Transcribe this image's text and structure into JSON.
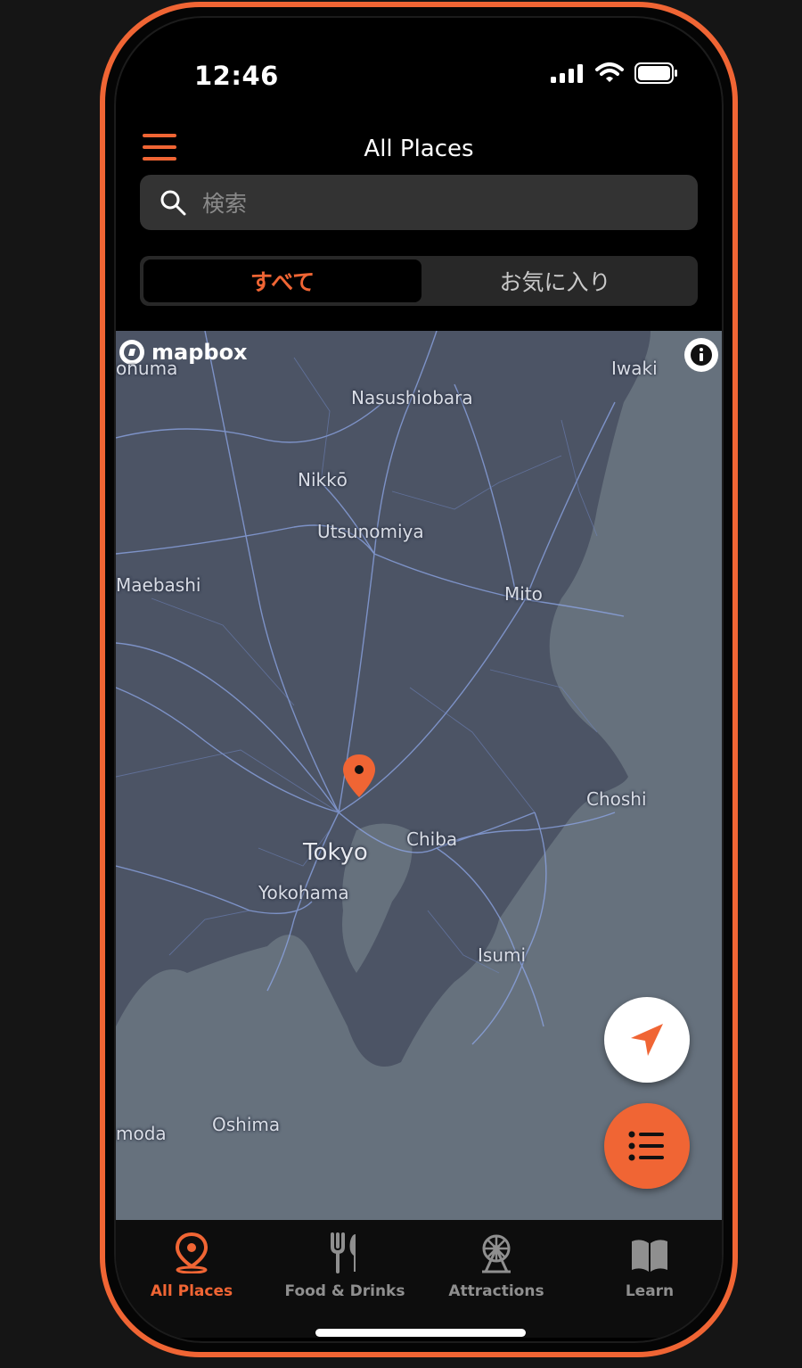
{
  "status_bar": {
    "time": "12:46"
  },
  "header": {
    "title": "All Places"
  },
  "search": {
    "placeholder": "検索"
  },
  "segment": {
    "all_label": "すべて",
    "favorites_label": "お気に入り",
    "selected": "all"
  },
  "map": {
    "attribution": "mapbox",
    "labels": [
      "onuma",
      "Iwaki",
      "Nasushiobara",
      "Nikkō",
      "Utsunomiya",
      "Maebashi",
      "Mito",
      "Choshi",
      "Chiba",
      "Tokyo",
      "Yokohama",
      "Isumi",
      "Oshima",
      "moda"
    ]
  },
  "tabs": [
    {
      "label": "All Places",
      "icon": "map-pin-icon",
      "active": true
    },
    {
      "label": "Food & Drinks",
      "icon": "fork-knife-icon",
      "active": false
    },
    {
      "label": "Attractions",
      "icon": "ferris-wheel-icon",
      "active": false
    },
    {
      "label": "Learn",
      "icon": "book-icon",
      "active": false
    }
  ],
  "colors": {
    "accent": "#f06534",
    "background": "#000000",
    "map_land": "#4d5566",
    "map_water": "#6a7580"
  }
}
